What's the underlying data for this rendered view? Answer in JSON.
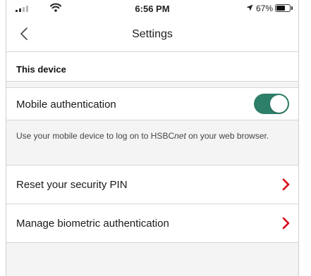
{
  "status_bar": {
    "time": "6:56 PM",
    "battery_percent": "67%",
    "battery_level": 0.67
  },
  "nav": {
    "title": "Settings",
    "back_icon": "chevron-left-icon"
  },
  "section": {
    "header": "This device"
  },
  "mobile_auth": {
    "label": "Mobile authentication",
    "enabled": true,
    "toggle_color": "#2d7f69"
  },
  "description": {
    "text_before": "Use your mobile device to log on to HSBC",
    "text_italic": "net",
    "text_after": " on your web browser."
  },
  "rows": {
    "reset_pin": "Reset your security PIN",
    "manage_biometric": "Manage biometric authentication"
  },
  "colors": {
    "chevron": "#db0011",
    "background": "#f4f4f4"
  }
}
